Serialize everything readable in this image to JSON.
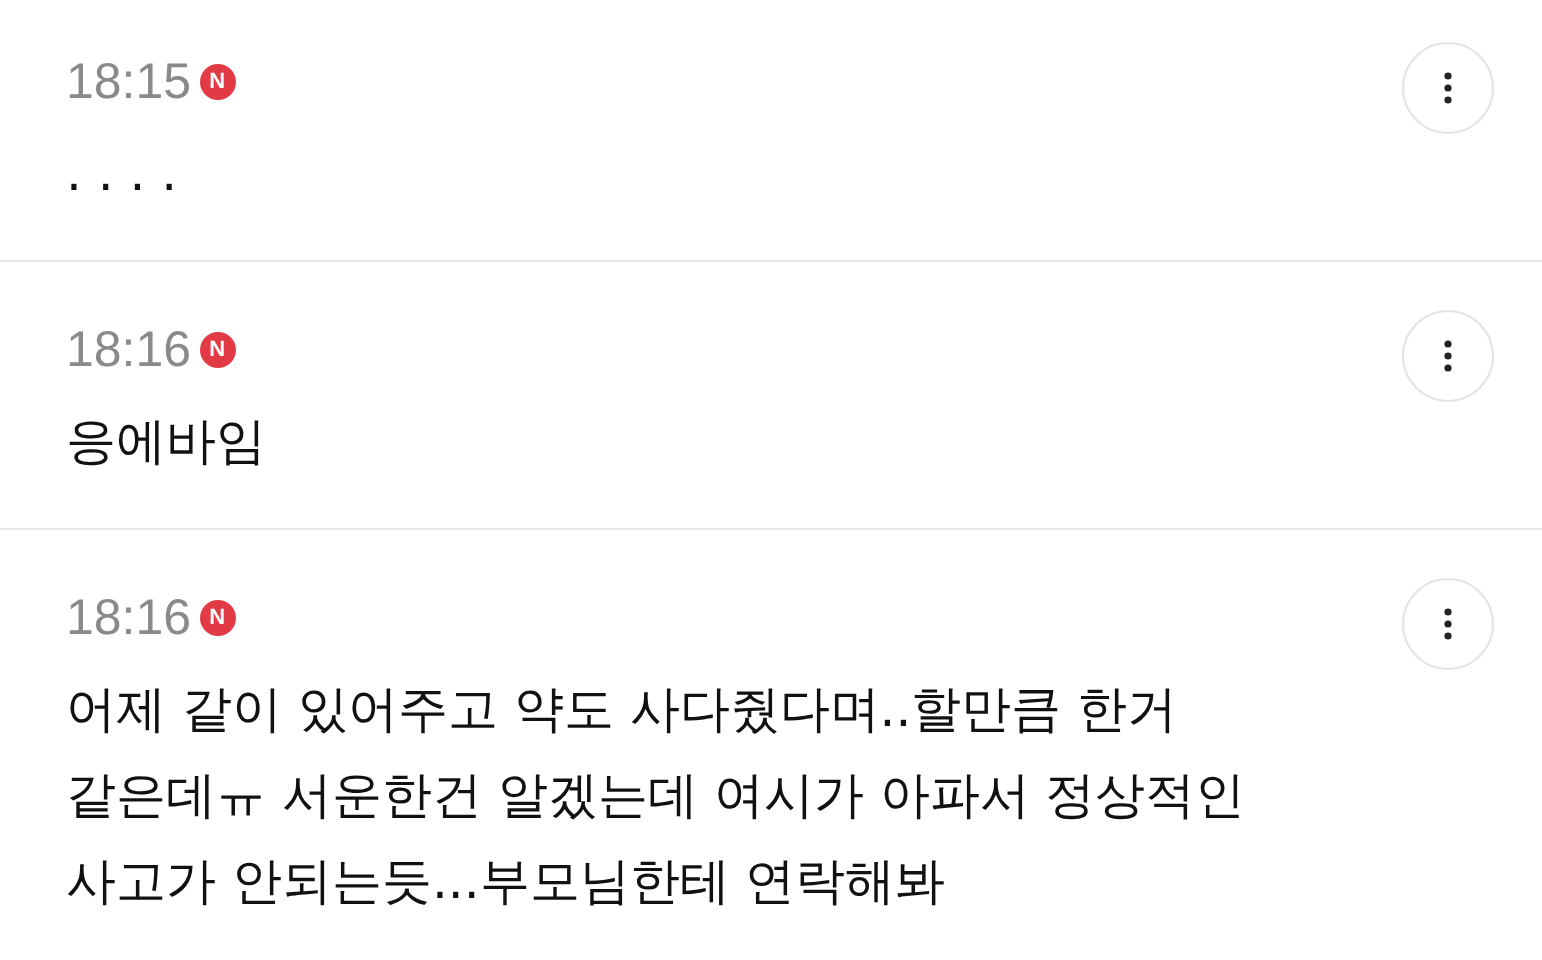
{
  "comments": [
    {
      "time": "18:15",
      "badge": "N",
      "lines": [
        ". . . ."
      ]
    },
    {
      "time": "18:16",
      "badge": "N",
      "lines": [
        "응에바임"
      ]
    },
    {
      "time": "18:16",
      "badge": "N",
      "lines": [
        "어제 같이 있어주고 약도 사다줬다며..할만큼 한거",
        "같은데ㅠ 서운한건 알겠는데 여시가 아파서 정상적인",
        "사고가 안되는듯...부모님한테 연락해봐"
      ]
    }
  ]
}
